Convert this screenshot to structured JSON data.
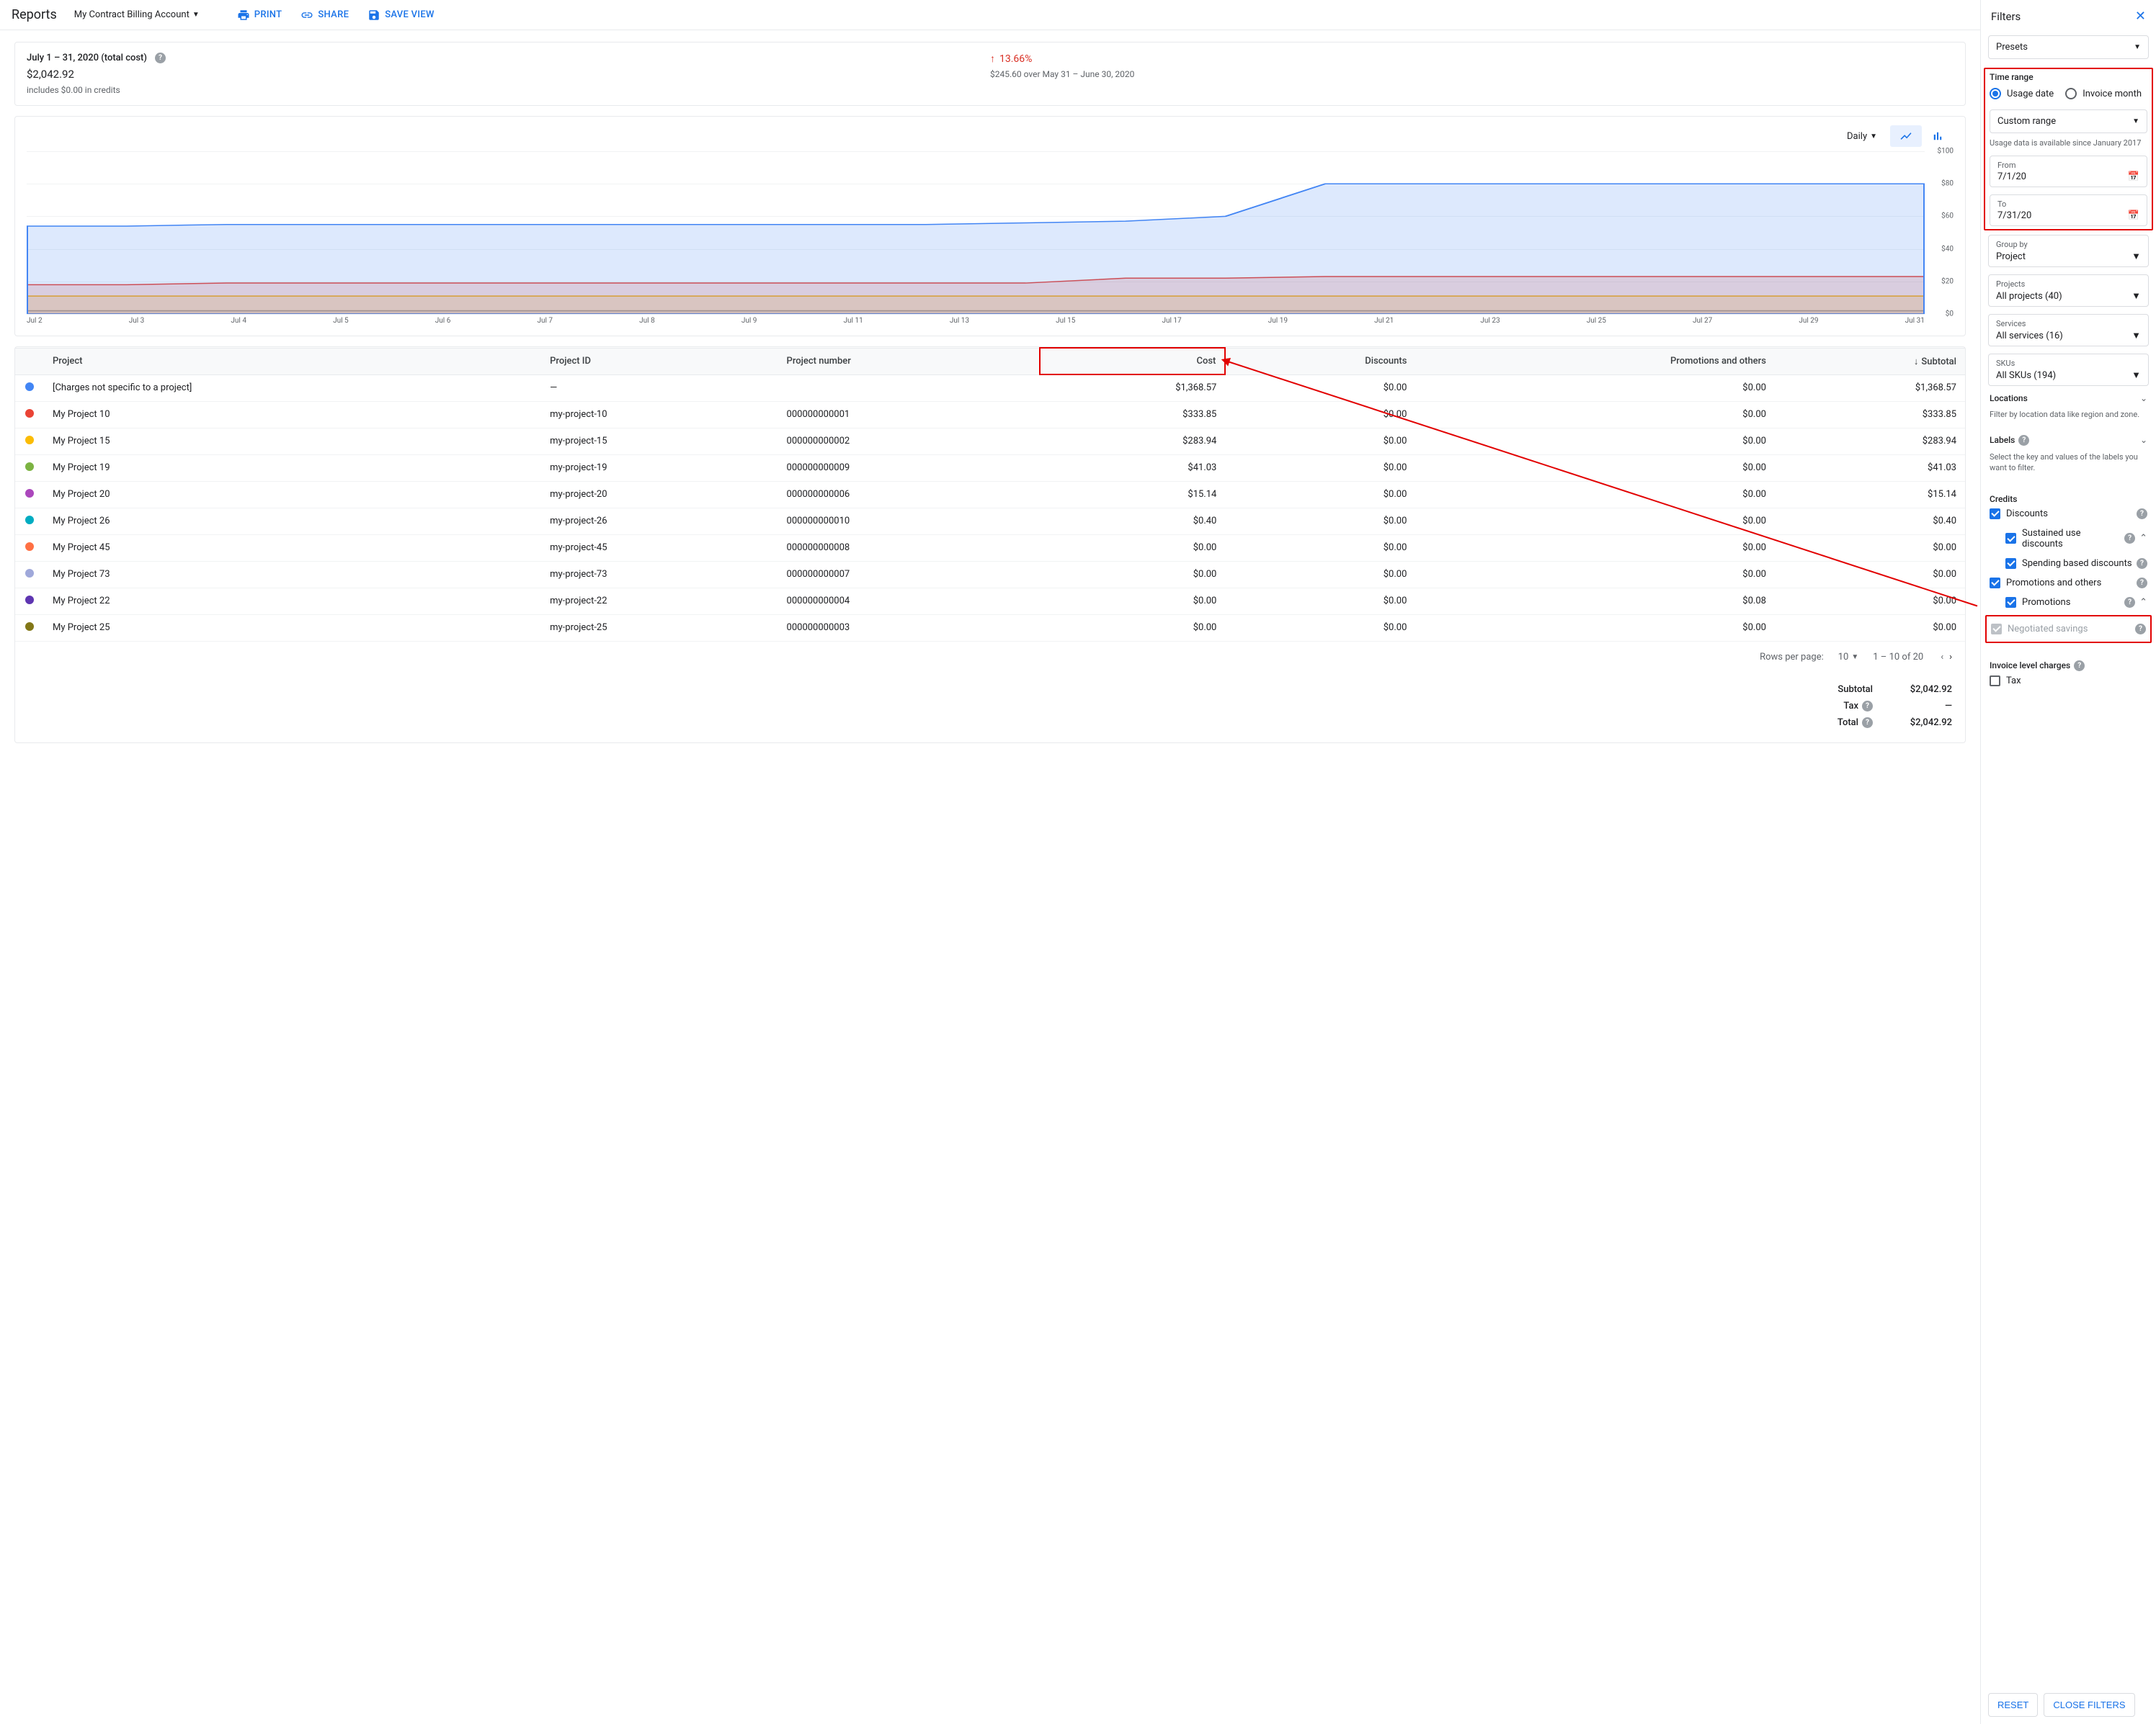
{
  "header": {
    "title": "Reports",
    "account": "My Contract Billing Account",
    "print": "PRINT",
    "share": "SHARE",
    "save_view": "SAVE VIEW"
  },
  "summary": {
    "label": "July 1 – 31, 2020 (total cost)",
    "amount": "$2,042.92",
    "credits_note": "includes $0.00 in credits",
    "delta_pct": "13.66%",
    "delta_note": "$245.60 over May 31 – June 30, 2020"
  },
  "chart": {
    "granularity": "Daily"
  },
  "chart_data": {
    "type": "area",
    "xlabel": "",
    "ylabel": "",
    "ylim": [
      0,
      100
    ],
    "yticks": [
      "$0",
      "$20",
      "$40",
      "$60",
      "$80",
      "$100"
    ],
    "categories": [
      "Jul 2",
      "Jul 3",
      "Jul 4",
      "Jul 5",
      "Jul 6",
      "Jul 7",
      "Jul 8",
      "Jul 9",
      "Jul 11",
      "Jul 13",
      "Jul 15",
      "Jul 17",
      "Jul 19",
      "Jul 21",
      "Jul 23",
      "Jul 25",
      "Jul 27",
      "Jul 29",
      "Jul 31"
    ],
    "series": [
      {
        "name": "[Charges not specific to a project]",
        "color": "#4285f4",
        "values": [
          54,
          54,
          55,
          55,
          55,
          55,
          55,
          55,
          55,
          55,
          56,
          57,
          60,
          80,
          80,
          80,
          80,
          80,
          80,
          80
        ]
      },
      {
        "name": "My Project 10",
        "color": "#ea4335",
        "values": [
          18,
          18,
          19,
          19,
          19,
          19,
          19,
          19,
          19,
          19,
          19,
          22,
          22,
          23,
          23,
          23,
          23,
          23,
          23,
          23
        ]
      },
      {
        "name": "My Project 15",
        "color": "#fbbc04",
        "values": [
          11,
          11,
          11,
          11,
          11,
          11,
          11,
          11,
          11,
          11,
          11,
          11,
          11,
          11,
          11,
          11,
          11,
          11,
          11,
          11
        ]
      },
      {
        "name": "Others",
        "color": "#9aa0a6",
        "values": [
          2,
          2,
          2,
          2,
          2,
          2,
          2,
          2,
          2,
          2,
          2,
          2,
          2,
          2,
          2,
          2,
          2,
          2,
          2,
          2
        ]
      }
    ]
  },
  "table": {
    "columns": {
      "project": "Project",
      "project_id": "Project ID",
      "project_number": "Project number",
      "cost": "Cost",
      "discounts": "Discounts",
      "promo": "Promotions and others",
      "subtotal": "Subtotal"
    },
    "rows": [
      {
        "c": "#4285f4",
        "project": "[Charges not specific to a project]",
        "project_id": "—",
        "project_number": "",
        "cost": "$1,368.57",
        "discounts": "$0.00",
        "promo": "$0.00",
        "subtotal": "$1,368.57"
      },
      {
        "c": "#ea4335",
        "project": "My Project 10",
        "project_id": "my-project-10",
        "project_number": "000000000001",
        "cost": "$333.85",
        "discounts": "$0.00",
        "promo": "$0.00",
        "subtotal": "$333.85"
      },
      {
        "c": "#fbbc04",
        "project": "My Project 15",
        "project_id": "my-project-15",
        "project_number": "000000000002",
        "cost": "$283.94",
        "discounts": "$0.00",
        "promo": "$0.00",
        "subtotal": "$283.94"
      },
      {
        "c": "#7cb342",
        "project": "My Project 19",
        "project_id": "my-project-19",
        "project_number": "000000000009",
        "cost": "$41.03",
        "discounts": "$0.00",
        "promo": "$0.00",
        "subtotal": "$41.03"
      },
      {
        "c": "#ab47bc",
        "project": "My Project 20",
        "project_id": "my-project-20",
        "project_number": "000000000006",
        "cost": "$15.14",
        "discounts": "$0.00",
        "promo": "$0.00",
        "subtotal": "$15.14"
      },
      {
        "c": "#00acc1",
        "project": "My Project 26",
        "project_id": "my-project-26",
        "project_number": "000000000010",
        "cost": "$0.40",
        "discounts": "$0.00",
        "promo": "$0.00",
        "subtotal": "$0.40"
      },
      {
        "c": "#ff7043",
        "project": "My Project 45",
        "project_id": "my-project-45",
        "project_number": "000000000008",
        "cost": "$0.00",
        "discounts": "$0.00",
        "promo": "$0.00",
        "subtotal": "$0.00"
      },
      {
        "c": "#9fa8da",
        "project": "My Project 73",
        "project_id": "my-project-73",
        "project_number": "000000000007",
        "cost": "$0.00",
        "discounts": "$0.00",
        "promo": "$0.00",
        "subtotal": "$0.00"
      },
      {
        "c": "#5e35b1",
        "project": "My Project 22",
        "project_id": "my-project-22",
        "project_number": "000000000004",
        "cost": "$0.00",
        "discounts": "$0.00",
        "promo": "$0.08",
        "subtotal": "$0.00"
      },
      {
        "c": "#827717",
        "project": "My Project 25",
        "project_id": "my-project-25",
        "project_number": "000000000003",
        "cost": "$0.00",
        "discounts": "$0.00",
        "promo": "$0.00",
        "subtotal": "$0.00"
      }
    ],
    "pager": {
      "rpp_lbl": "Rows per page:",
      "rpp": "10",
      "range": "1 – 10 of 20"
    }
  },
  "totals": {
    "subtotal_lbl": "Subtotal",
    "subtotal": "$2,042.92",
    "tax_lbl": "Tax",
    "tax": "—",
    "total_lbl": "Total",
    "total": "$2,042.92"
  },
  "filters": {
    "title": "Filters",
    "presets": "Presets",
    "time_range": {
      "title": "Time range",
      "usage": "Usage date",
      "invoice": "Invoice month",
      "range_type": "Custom range",
      "hint": "Usage data is available since January 2017",
      "from_lbl": "From",
      "from": "7/1/20",
      "to_lbl": "To",
      "to": "7/31/20"
    },
    "group_by": {
      "lbl": "Group by",
      "val": "Project"
    },
    "projects": {
      "lbl": "Projects",
      "val": "All projects (40)"
    },
    "services": {
      "lbl": "Services",
      "val": "All services (16)"
    },
    "skus": {
      "lbl": "SKUs",
      "val": "All SKUs (194)"
    },
    "locations": {
      "title": "Locations",
      "hint": "Filter by location data like region and zone."
    },
    "labels": {
      "title": "Labels",
      "hint": "Select the key and values of the labels you want to filter."
    },
    "credits": {
      "title": "Credits",
      "discounts": "Discounts",
      "sustained": "Sustained use discounts",
      "spending": "Spending based discounts",
      "promo": "Promotions and others",
      "promotions": "Promotions",
      "negotiated": "Negotiated savings"
    },
    "invoice": {
      "title": "Invoice level charges",
      "tax": "Tax"
    },
    "reset": "RESET",
    "close": "CLOSE FILTERS"
  }
}
